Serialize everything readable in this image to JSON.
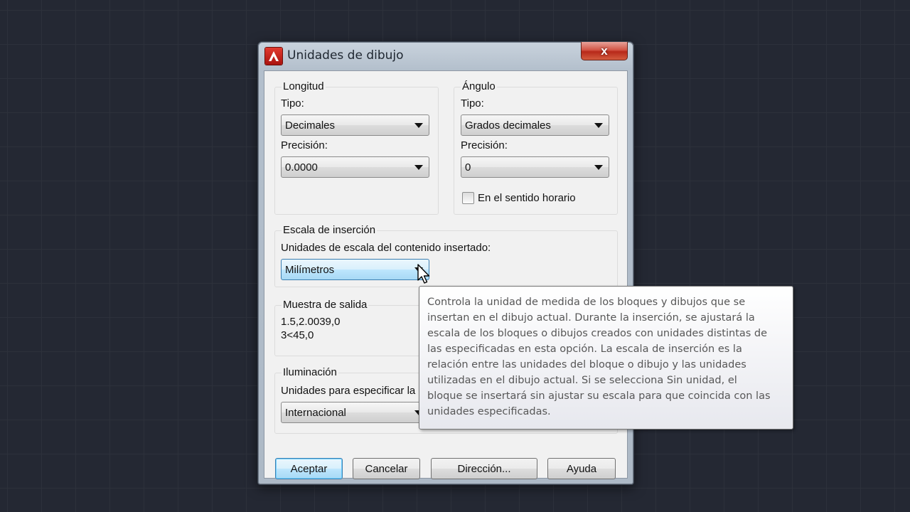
{
  "window": {
    "title": "Unidades de dibujo",
    "close_label": "x"
  },
  "length": {
    "group_title": "Longitud",
    "type_label": "Tipo:",
    "type_value": "Decimales",
    "precision_label": "Precisión:",
    "precision_value": "0.0000"
  },
  "angle": {
    "group_title": "Ángulo",
    "type_label": "Tipo:",
    "type_value": "Grados decimales",
    "precision_label": "Precisión:",
    "precision_value": "0",
    "clockwise_label": "En el sentido horario",
    "clockwise_checked": false
  },
  "insertion": {
    "group_title": "Escala de inserción",
    "units_label": "Unidades de escala del contenido insertado:",
    "units_value": "Milímetros"
  },
  "sample": {
    "group_title": "Muestra de salida",
    "line1": "1.5,2.0039,0",
    "line2": "3<45,0"
  },
  "lighting": {
    "group_title": "Iluminación",
    "units_label": "Unidades para especificar la",
    "units_value": "Internacional"
  },
  "buttons": {
    "ok": "Aceptar",
    "cancel": "Cancelar",
    "direction": "Dirección...",
    "help": "Ayuda"
  },
  "tooltip": {
    "line1": "Controla la unidad de medida de los bloques y dibujos que se",
    "line2": "insertan en el dibujo actual. Durante la inserción, se ajustará la",
    "line3": "escala de los bloques o dibujos creados con unidades distintas de",
    "line4": "las especificadas en esta opción. La escala de inserción es la",
    "line5": "relación entre las unidades del bloque o dibujo y las unidades",
    "line6": "utilizadas en el dibujo actual. Si se selecciona Sin unidad, el",
    "line7": "bloque se insertará sin ajustar su escala para que coincida con las",
    "line8": "unidades especificadas."
  },
  "colors": {
    "background": "#242833",
    "accent": "#3c7fb1",
    "close_button": "#c8392a"
  }
}
